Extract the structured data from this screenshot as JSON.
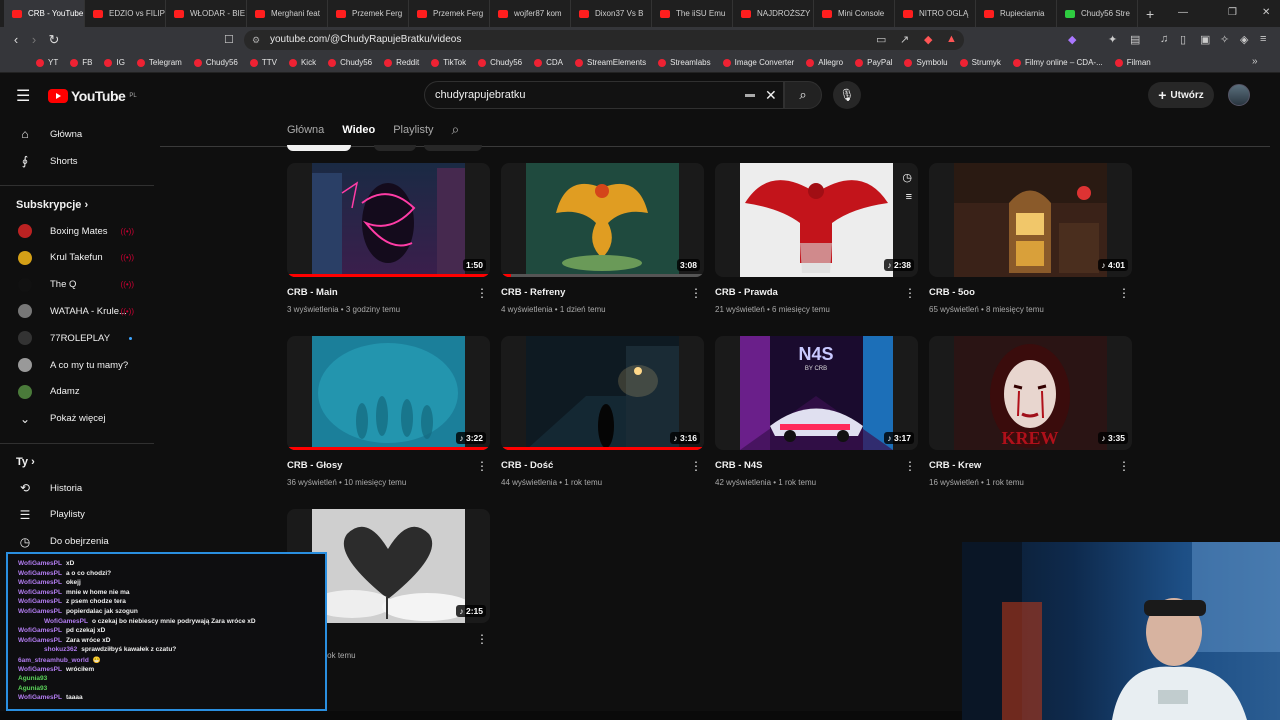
{
  "browser": {
    "tabs": [
      {
        "label": "CRB - YouTube",
        "fav": "red",
        "active": true
      },
      {
        "label": "EDZIO vs FILIP",
        "fav": "red"
      },
      {
        "label": "WŁODAR - BIE",
        "fav": "red"
      },
      {
        "label": "Merghani feat",
        "fav": "red"
      },
      {
        "label": "Przemek Ferg",
        "fav": "red"
      },
      {
        "label": "Przemek Ferg",
        "fav": "red"
      },
      {
        "label": "wojfer87 kom",
        "fav": "red"
      },
      {
        "label": "Dixon37 Vs B",
        "fav": "red"
      },
      {
        "label": "The iiSU Emu",
        "fav": "red"
      },
      {
        "label": "NAJDROŻSZY",
        "fav": "red"
      },
      {
        "label": "Mini Console",
        "fav": "red"
      },
      {
        "label": "NITRO OGLĄ",
        "fav": "red"
      },
      {
        "label": "Rupieciarnia",
        "fav": "red"
      },
      {
        "label": "Chudy56 Stre",
        "fav": "green"
      }
    ],
    "url": "youtube.com/@ChudyRapujeBratku/videos",
    "bookmarks": [
      "YT",
      "FB",
      "IG",
      "Telegram",
      "Chudy56",
      "TTV",
      "Kick",
      "Chudy56",
      "Reddit",
      "TikTok",
      "Chudy56",
      "CDA",
      "StreamElements",
      "Streamlabs",
      "Image Converter",
      "Allegro",
      "PayPal",
      "Symbolu",
      "Strumyk",
      "Filmy online – CDA-...",
      "Filman"
    ]
  },
  "youtube": {
    "logo_text": "YouTube",
    "logo_region": "PL",
    "search_value": "chudyrapujebratku",
    "create_label": "Utwórz"
  },
  "sidebar": {
    "top": [
      {
        "label": "Główna",
        "icon": "home-icon"
      },
      {
        "label": "Shorts",
        "icon": "shorts-icon"
      }
    ],
    "subs_heading": "Subskrypcje",
    "subs": [
      {
        "label": "Boxing Mates",
        "color": "#b22",
        "badge": "live"
      },
      {
        "label": "Krul Takefun",
        "color": "#d4a017",
        "badge": "live"
      },
      {
        "label": "The Q",
        "color": "#111",
        "badge": "live"
      },
      {
        "label": "WATAHA - Krule...",
        "color": "#777",
        "badge": "live"
      },
      {
        "label": "77ROLEPLAY",
        "color": "#333",
        "badge": "dot"
      },
      {
        "label": "A co my tu mamy?",
        "color": "#999",
        "badge": ""
      },
      {
        "label": "Adamz",
        "color": "#4a7a3a",
        "badge": ""
      },
      {
        "label": "Pokaż więcej",
        "color": "",
        "badge": ""
      }
    ],
    "you_heading": "Ty",
    "you": [
      {
        "label": "Historia",
        "icon": "history-icon"
      },
      {
        "label": "Playlisty",
        "icon": "playlist-icon"
      },
      {
        "label": "Do obejrzenia",
        "icon": "watch-later-icon"
      }
    ]
  },
  "channel_tabs": [
    "Główna",
    "Wideo",
    "Playlisty"
  ],
  "videos": [
    {
      "title": "CRB - Main",
      "meta": "3 wyświetlenia • 3 godziny temu",
      "duration": "1:50",
      "progress": 1.0,
      "short": false
    },
    {
      "title": "CRB - Refreny",
      "meta": "4 wyświetlenia • 1 dzień temu",
      "duration": "3:08",
      "progress": 0.05,
      "short": false
    },
    {
      "title": "CRB - Prawda",
      "meta": "21 wyświetleń • 6 miesięcy temu",
      "duration": "2:38",
      "progress": 0.0,
      "short": true
    },
    {
      "title": "CRB - 5oo",
      "meta": "65 wyświetleń • 8 miesięcy temu",
      "duration": "4:01",
      "progress": 0.0,
      "short": true
    },
    {
      "title": "CRB - Głosy",
      "meta": "36 wyświetleń • 10 miesięcy temu",
      "duration": "3:22",
      "progress": 1.0,
      "short": true
    },
    {
      "title": "CRB - Dość",
      "meta": "44 wyświetlenia • 1 rok temu",
      "duration": "3:16",
      "progress": 1.0,
      "short": true
    },
    {
      "title": "CRB - N4S",
      "meta": "42 wyświetlenia • 1 rok temu",
      "duration": "3:17",
      "progress": 0.0,
      "short": true
    },
    {
      "title": "CRB - Krew",
      "meta": "16 wyświetleń • 1 rok temu",
      "duration": "3:35",
      "progress": 0.0,
      "short": true
    },
    {
      "title": "...o",
      "meta": "...lenia • 1 rok temu",
      "duration": "2:15",
      "progress": 0.0,
      "short": true
    }
  ],
  "thumb_texts": {
    "n4s": "N4S",
    "n4s_sub": "BY CRB",
    "krew": "KREW"
  },
  "chat": [
    {
      "user": "WofiGamesPL",
      "msg": "xD",
      "green": false,
      "indent": false
    },
    {
      "user": "WofiGamesPL",
      "msg": "a o co chodzi?",
      "green": false,
      "indent": false
    },
    {
      "user": "WofiGamesPL",
      "msg": "okejj",
      "green": false,
      "indent": false
    },
    {
      "user": "WofiGamesPL",
      "msg": "mnie w home nie ma",
      "green": false,
      "indent": false
    },
    {
      "user": "WofiGamesPL",
      "msg": "z psem chodze tera",
      "green": false,
      "indent": false
    },
    {
      "user": "WofiGamesPL",
      "msg": "popierdalac jak szogun",
      "green": false,
      "indent": false
    },
    {
      "user": "WofiGamesPL",
      "msg": "o czekaj bo niebiescy mnie podrywają Zara wróce xD",
      "green": false,
      "indent": true
    },
    {
      "user": "WofiGamesPL",
      "msg": "pd czekaj xD",
      "green": false,
      "indent": false
    },
    {
      "user": "WofiGamesPL",
      "msg": "Zara wróce xD",
      "green": false,
      "indent": false
    },
    {
      "user": "shokuz362",
      "msg": "sprawdziłbyś kawałek z czatu?",
      "green": false,
      "indent": true
    },
    {
      "user": "6am_streamhub_world",
      "msg": "😁",
      "green": false,
      "indent": false
    },
    {
      "user": "WofiGamesPL",
      "msg": "wróciłem",
      "green": false,
      "indent": false
    },
    {
      "user": "Agunia93",
      "msg": "",
      "green": true,
      "indent": false
    },
    {
      "user": "Agunia93",
      "msg": "",
      "green": true,
      "indent": false
    },
    {
      "user": "WofiGamesPL",
      "msg": "taaaa",
      "green": false,
      "indent": false
    }
  ]
}
